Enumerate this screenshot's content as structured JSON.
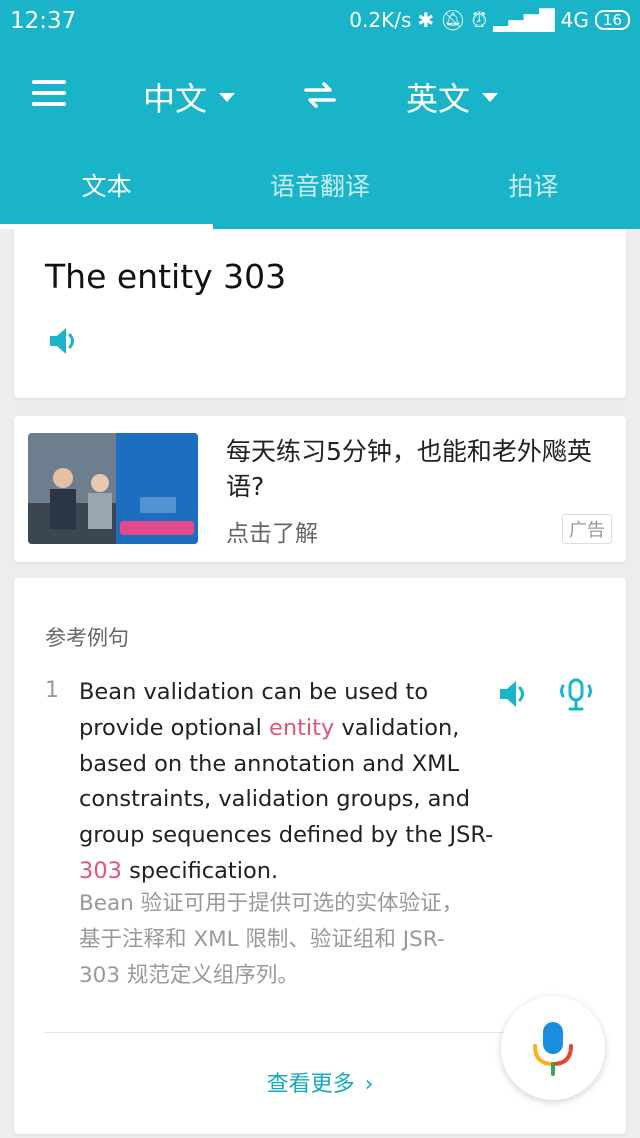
{
  "status": {
    "time": "12:37",
    "net_speed": "0.2K/s",
    "network": "4G",
    "battery": "16"
  },
  "toolbar": {
    "source_lang": "中文",
    "target_lang": "英文"
  },
  "tabs": [
    {
      "label": "文本",
      "active": true
    },
    {
      "label": "语音翻译",
      "active": false
    },
    {
      "label": "拍译",
      "active": false
    }
  ],
  "result": {
    "text": "The entity 303"
  },
  "ad": {
    "title": "每天练习5分钟，也能和老外飚英语?",
    "link": "点击了解",
    "badge": "广告"
  },
  "examples": {
    "heading": "参考例句",
    "items": [
      {
        "index": "1",
        "en_parts": [
          "Bean validation can be used to provide optional ",
          "entity",
          " validation, based on the annotation and XML constraints, validation groups, and group sequences defined by the JSR-",
          "303",
          " specification."
        ],
        "zh": "Bean 验证可用于提供可选的实体验证，基于注释和 XML 限制、验证组和 JSR-303 规范定义组序列。"
      }
    ],
    "more_label": "查看更多"
  },
  "colors": {
    "accent": "#1ab4c8",
    "highlight": "#e2557a"
  },
  "icons": [
    "menu-icon",
    "swap-icon",
    "speaker-icon",
    "voice-icon",
    "mic-icon",
    "chevron-right-icon"
  ]
}
